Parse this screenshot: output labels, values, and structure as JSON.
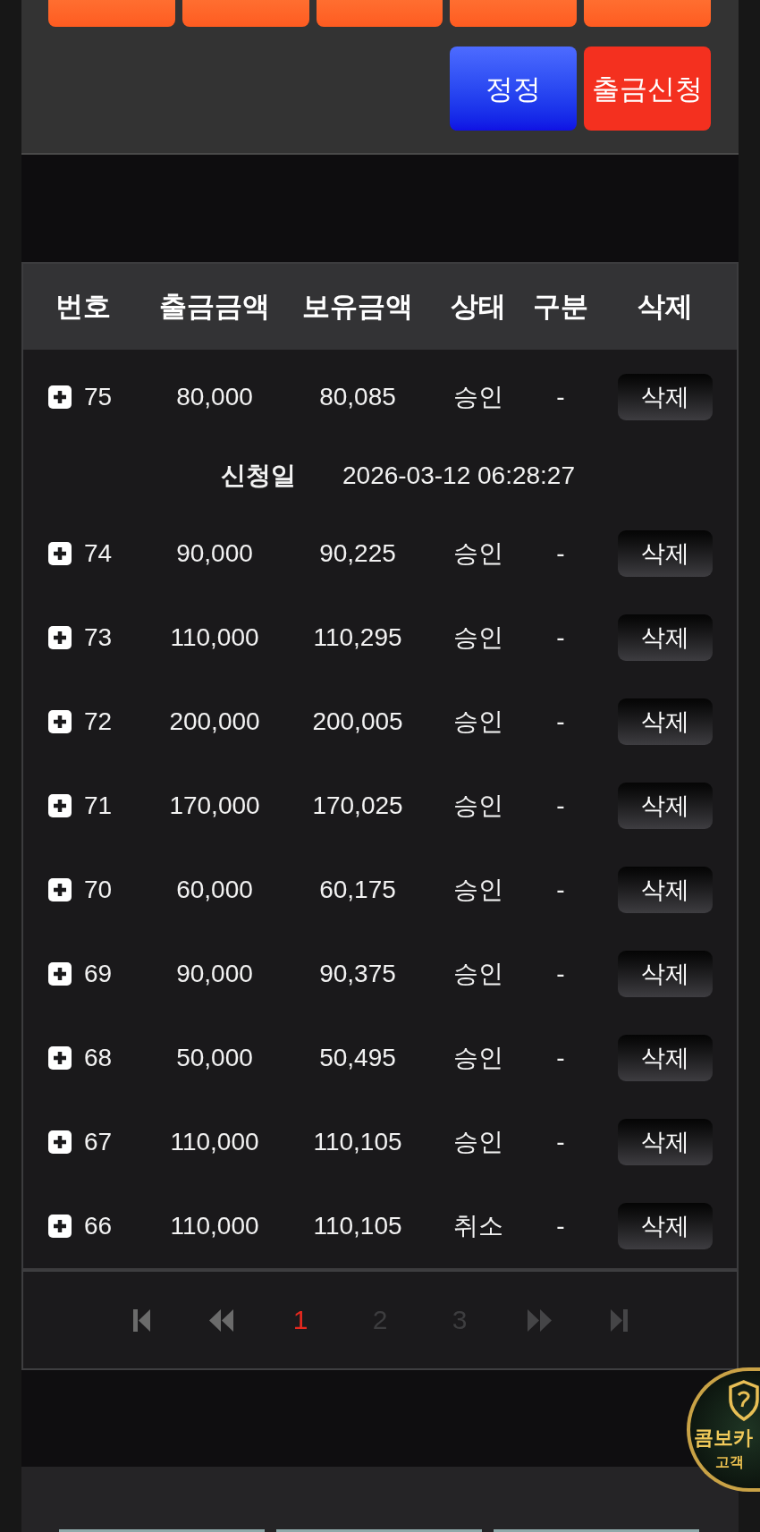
{
  "form": {
    "buttons": [
      {
        "kind": "preset"
      },
      {
        "kind": "preset"
      },
      {
        "kind": "preset"
      },
      {
        "kind": "preset"
      },
      {
        "kind": "preset"
      },
      {
        "kind": "reset",
        "label": "정정"
      },
      {
        "kind": "submit",
        "label": "출금신청"
      }
    ]
  },
  "table": {
    "columns": [
      "번호",
      "출금금액",
      "보유금액",
      "상태",
      "구분",
      "삭제"
    ],
    "rows": [
      {
        "number": "75",
        "amount": "80,000",
        "balance": "80,085",
        "status": "승인",
        "category": "-",
        "action": "삭제",
        "detail": {
          "label": "신청일",
          "value": "2026-03-12 06:28:27"
        }
      },
      {
        "number": "74",
        "amount": "90,000",
        "balance": "90,225",
        "status": "승인",
        "category": "-",
        "action": "삭제"
      },
      {
        "number": "73",
        "amount": "110,000",
        "balance": "110,295",
        "status": "승인",
        "category": "-",
        "action": "삭제"
      },
      {
        "number": "72",
        "amount": "200,000",
        "balance": "200,005",
        "status": "승인",
        "category": "-",
        "action": "삭제"
      },
      {
        "number": "71",
        "amount": "170,000",
        "balance": "170,025",
        "status": "승인",
        "category": "-",
        "action": "삭제"
      },
      {
        "number": "70",
        "amount": "60,000",
        "balance": "60,175",
        "status": "승인",
        "category": "-",
        "action": "삭제"
      },
      {
        "number": "69",
        "amount": "90,000",
        "balance": "90,375",
        "status": "승인",
        "category": "-",
        "action": "삭제"
      },
      {
        "number": "68",
        "amount": "50,000",
        "balance": "50,495",
        "status": "승인",
        "category": "-",
        "action": "삭제"
      },
      {
        "number": "67",
        "amount": "110,000",
        "balance": "110,105",
        "status": "승인",
        "category": "-",
        "action": "삭제"
      },
      {
        "number": "66",
        "amount": "110,000",
        "balance": "110,105",
        "status": "취소",
        "category": "-",
        "action": "삭제"
      }
    ]
  },
  "pagination": [
    {
      "kind": "first"
    },
    {
      "kind": "prev"
    },
    {
      "kind": "page",
      "label": "1",
      "selected": true
    },
    {
      "kind": "page",
      "label": "2",
      "selected": false
    },
    {
      "kind": "page",
      "label": "3",
      "selected": false
    },
    {
      "kind": "next"
    },
    {
      "kind": "last"
    }
  ],
  "badge": {
    "title": "콤보카",
    "subtitle": "고객"
  },
  "footer": {
    "thumbnails": [
      {
        "kind": "image"
      },
      {
        "kind": "image"
      },
      {
        "kind": "image"
      }
    ]
  }
}
